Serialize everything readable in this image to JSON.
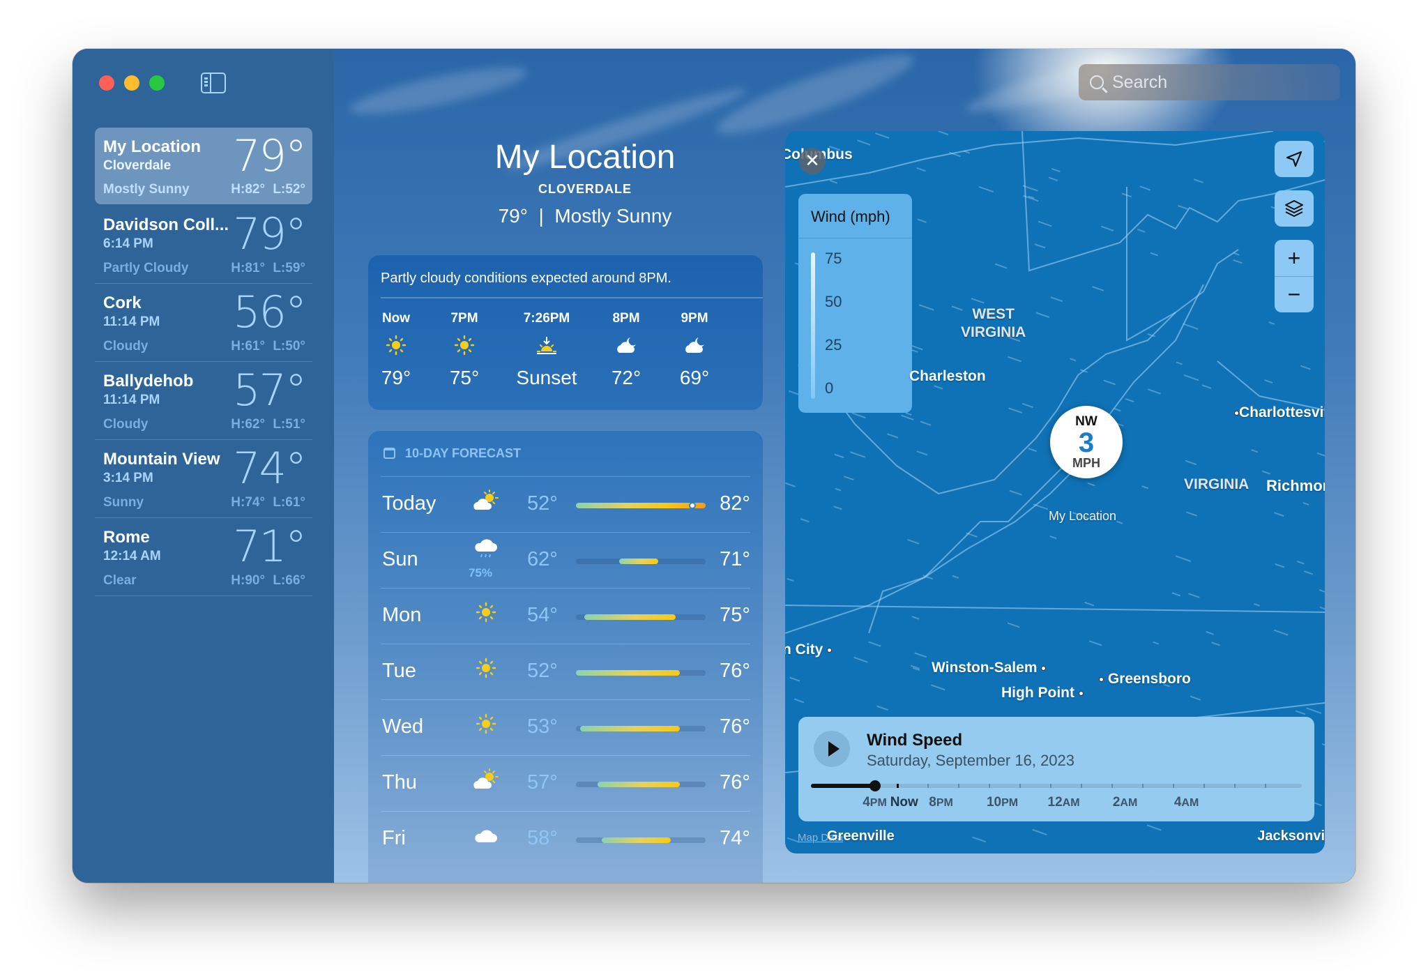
{
  "window": {
    "controls": [
      "close",
      "minimize",
      "zoom"
    ],
    "sidebar_toggle_icon": "sidebar-toggle-icon"
  },
  "sidebar": {
    "locations": [
      {
        "name": "My Location",
        "sub": "Cloverdale",
        "temp": "79°",
        "condition": "Mostly Sunny",
        "high_low": "H:82° L:52°",
        "selected": true
      },
      {
        "name": "Davidson Coll...",
        "sub": "6:14 PM",
        "temp": "79°",
        "condition": "Partly Cloudy",
        "high_low": "H:81° L:59°"
      },
      {
        "name": "Cork",
        "sub": "11:14 PM",
        "temp": "56°",
        "condition": "Cloudy",
        "high_low": "H:61° L:50°"
      },
      {
        "name": "Ballydehob",
        "sub": "11:14 PM",
        "temp": "57°",
        "condition": "Cloudy",
        "high_low": "H:62° L:51°"
      },
      {
        "name": "Mountain View",
        "sub": "3:14 PM",
        "temp": "74°",
        "condition": "Sunny",
        "high_low": "H:74° L:61°"
      },
      {
        "name": "Rome",
        "sub": "12:14 AM",
        "temp": "71°",
        "condition": "Clear",
        "high_low": "H:90° L:66°"
      }
    ]
  },
  "search": {
    "placeholder": "Search",
    "icon": "search-icon"
  },
  "hero": {
    "title": "My Location",
    "subtitle": "CLOVERDALE",
    "current": "79°  |  Mostly Sunny"
  },
  "hourly": {
    "summary": "Partly cloudy conditions expected around 8PM.",
    "items": [
      {
        "time": "Now",
        "icon": "sun",
        "value": "79°"
      },
      {
        "time": "7PM",
        "icon": "sun",
        "value": "75°"
      },
      {
        "time": "7:26PM",
        "icon": "sunset",
        "value": "Sunset"
      },
      {
        "time": "8PM",
        "icon": "cloud-moon",
        "value": "72°"
      },
      {
        "time": "9PM",
        "icon": "cloud-moon",
        "value": "69°"
      }
    ]
  },
  "daily": {
    "header": "10-DAY FORECAST",
    "range_min": 52,
    "range_max": 82,
    "current_temp": 79,
    "days": [
      {
        "day": "Today",
        "icon": "cloud-sun",
        "low": 52,
        "high": 82,
        "low_label": "52°",
        "high_label": "82°",
        "precip": ""
      },
      {
        "day": "Sun",
        "icon": "cloud-rain",
        "low": 62,
        "high": 71,
        "low_label": "62°",
        "high_label": "71°",
        "precip": "75%"
      },
      {
        "day": "Mon",
        "icon": "sun",
        "low": 54,
        "high": 75,
        "low_label": "54°",
        "high_label": "75°",
        "precip": ""
      },
      {
        "day": "Tue",
        "icon": "sun",
        "low": 52,
        "high": 76,
        "low_label": "52°",
        "high_label": "76°",
        "precip": ""
      },
      {
        "day": "Wed",
        "icon": "sun",
        "low": 53,
        "high": 76,
        "low_label": "53°",
        "high_label": "76°",
        "precip": ""
      },
      {
        "day": "Thu",
        "icon": "cloud-sun",
        "low": 57,
        "high": 76,
        "low_label": "57°",
        "high_label": "76°",
        "precip": ""
      },
      {
        "day": "Fri",
        "icon": "cloud",
        "low": 58,
        "high": 74,
        "low_label": "58°",
        "high_label": "74°",
        "precip": ""
      }
    ]
  },
  "map": {
    "close_label": "✕",
    "legend": {
      "title": "Wind (mph)",
      "ticks": [
        "75",
        "50",
        "25",
        "0"
      ]
    },
    "controls": {
      "locate_icon": "location-arrow-icon",
      "layers_icon": "layers-icon",
      "zoom_in": "+",
      "zoom_out": "−"
    },
    "wind_marker": {
      "direction": "NW",
      "speed": "3",
      "unit": "MPH"
    },
    "labels": {
      "columbus": "Columbus",
      "west_virginia_1": "WEST",
      "west_virginia_2": "VIRGINIA",
      "charleston": "Charleston",
      "charlottesville": "Charlottesvil",
      "virginia": "VIRGINIA",
      "richmond": "Richmor",
      "my_location": "My Location",
      "johnson_city": "n City",
      "winston_salem": "Winston-Salem",
      "high_point": "High Point",
      "greensboro": "Greensboro",
      "greenville": "Greenville",
      "jacksonville": "Jacksonvi"
    },
    "playback": {
      "title": "Wind Speed",
      "date": "Saturday, September 16, 2023",
      "progress": 0.13,
      "now_position": 0.19,
      "labels": [
        {
          "num": "4",
          "suffix": "PM",
          "pos": 0.13
        },
        {
          "num": "Now",
          "suffix": "",
          "pos": 0.19,
          "now": true
        },
        {
          "num": "8",
          "suffix": "PM",
          "pos": 0.265
        },
        {
          "num": "10",
          "suffix": "PM",
          "pos": 0.39
        },
        {
          "num": "12",
          "suffix": "AM",
          "pos": 0.515
        },
        {
          "num": "2",
          "suffix": "AM",
          "pos": 0.64
        },
        {
          "num": "4",
          "suffix": "AM",
          "pos": 0.765
        }
      ]
    },
    "attribution": "Map Data"
  }
}
